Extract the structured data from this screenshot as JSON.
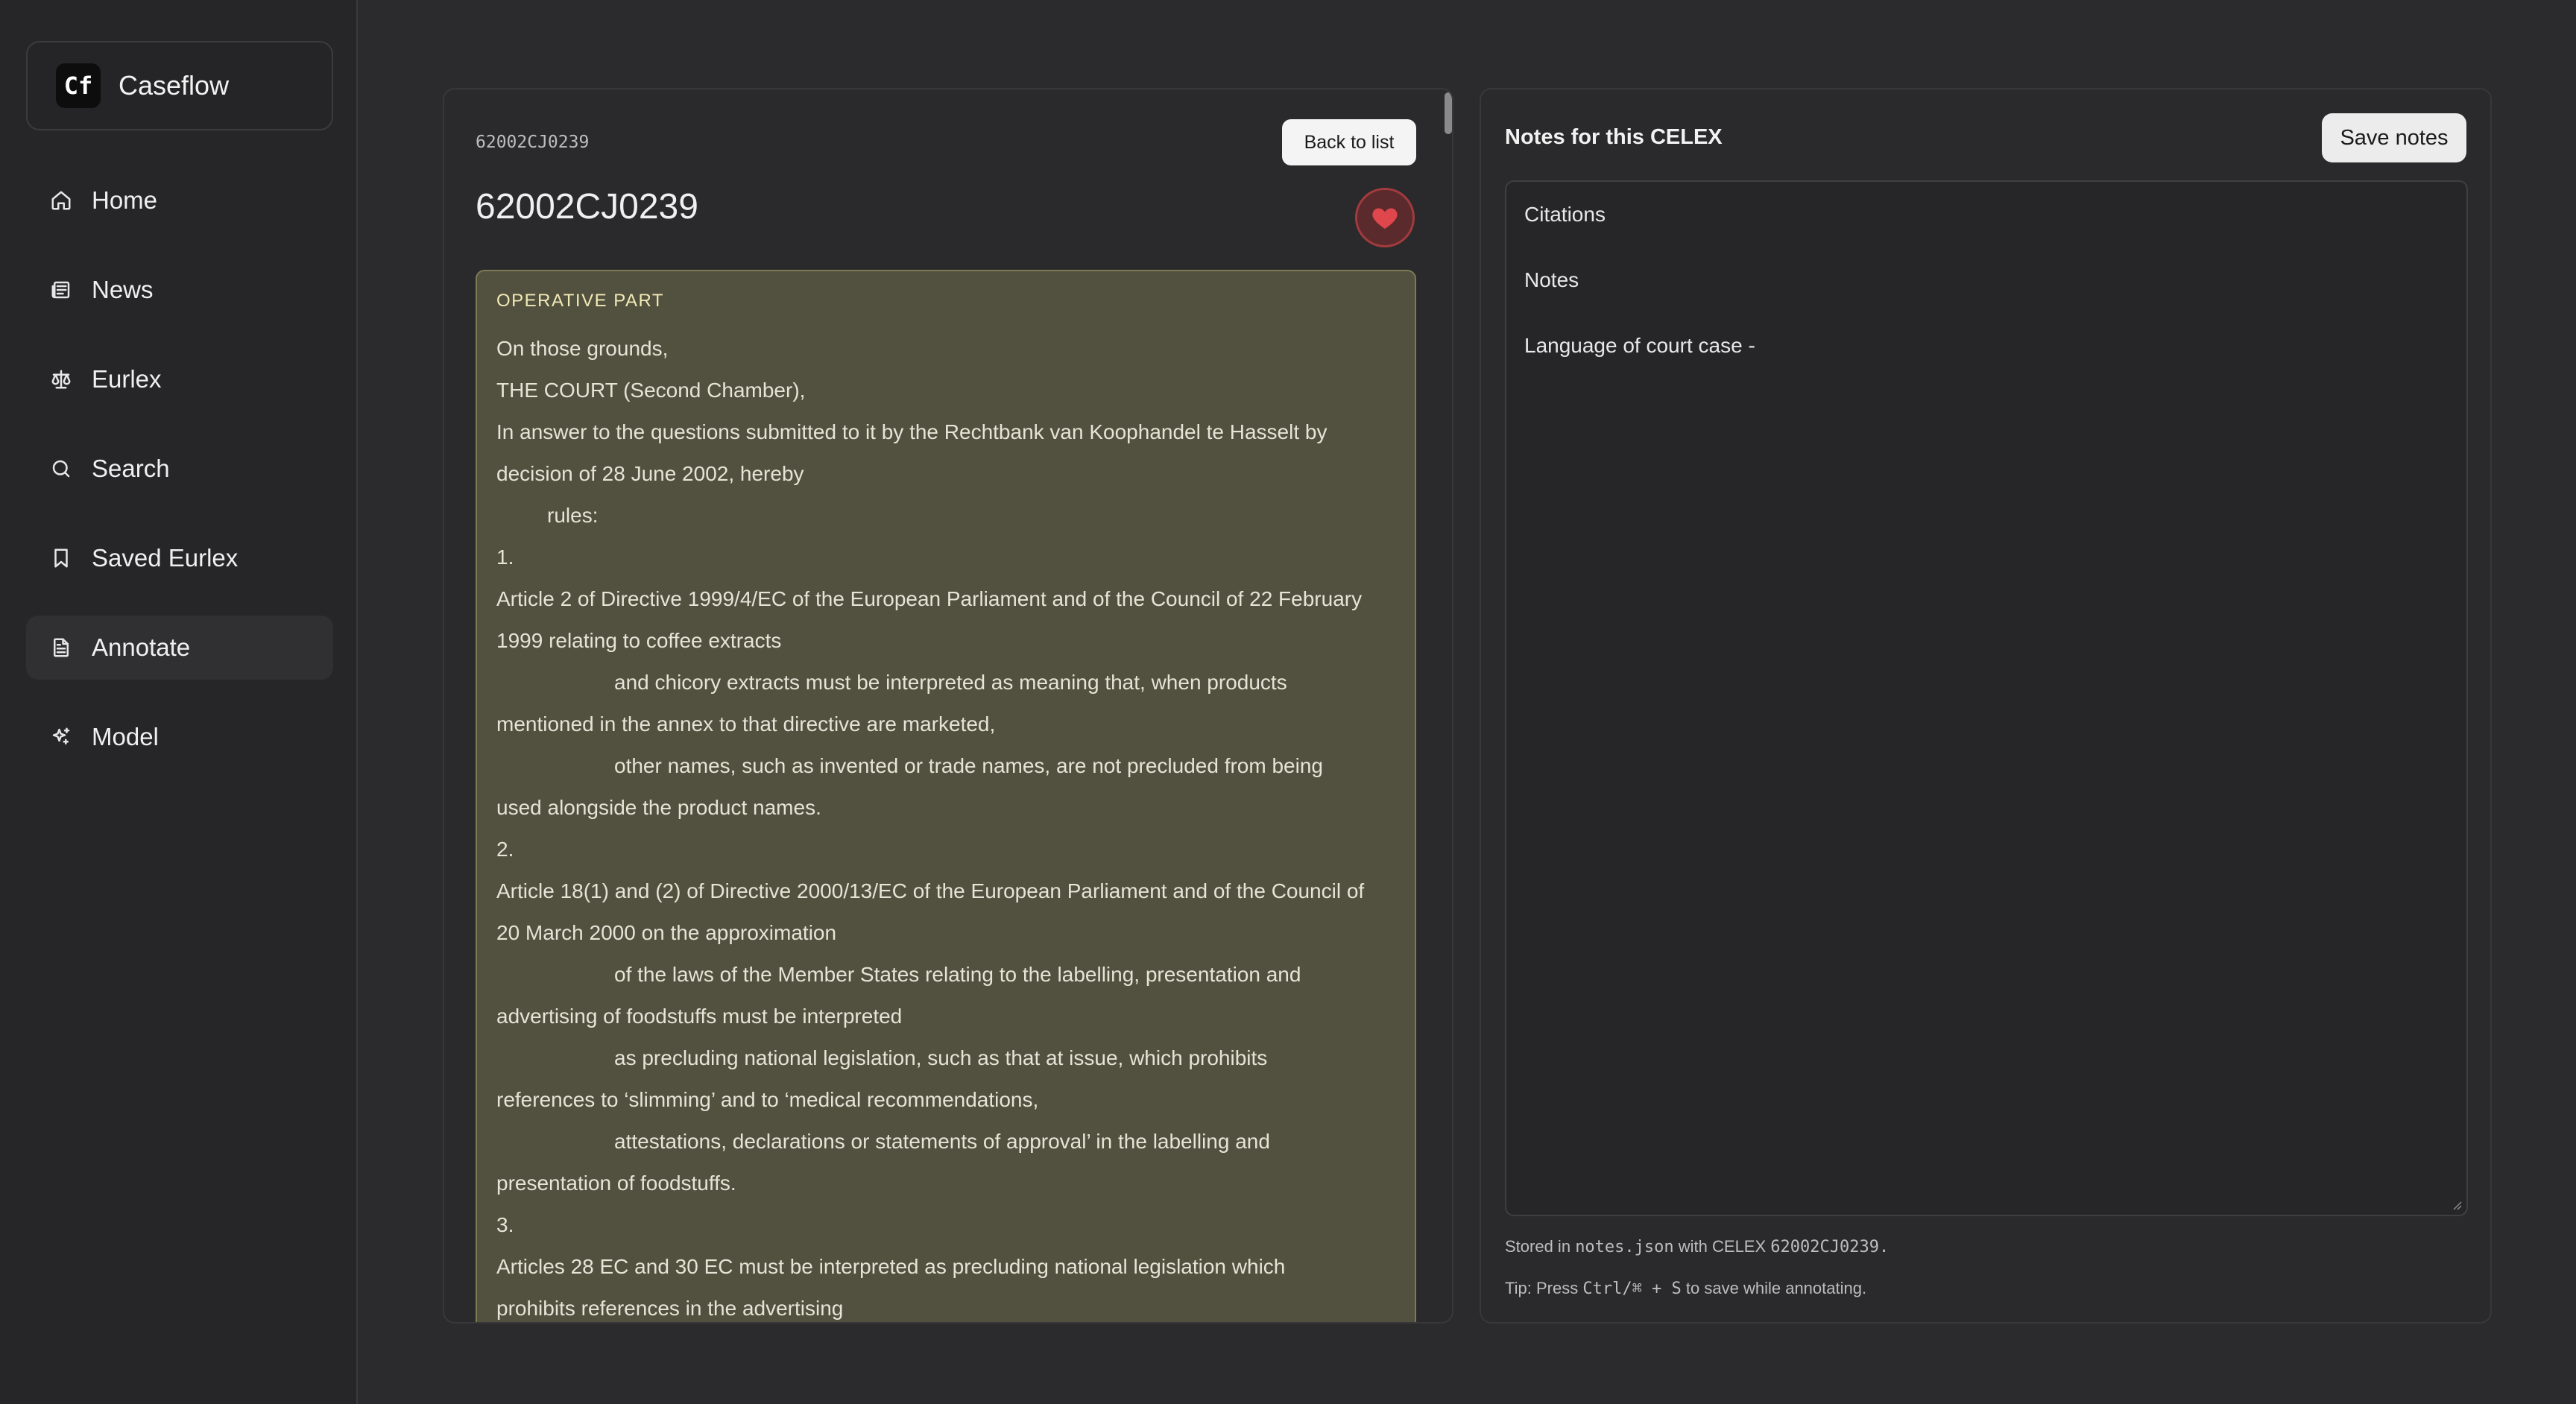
{
  "sidebar": {
    "brand": {
      "logo": "Cf",
      "name": "Caseflow"
    },
    "items": [
      {
        "label": "Home",
        "icon": "home-icon"
      },
      {
        "label": "News",
        "icon": "newspaper-icon"
      },
      {
        "label": "Eurlex",
        "icon": "scale-icon"
      },
      {
        "label": "Search",
        "icon": "search-icon"
      },
      {
        "label": "Saved Eurlex",
        "icon": "bookmark-icon"
      },
      {
        "label": "Annotate",
        "icon": "document-icon",
        "active": true
      },
      {
        "label": "Model",
        "icon": "sparkles-icon"
      }
    ]
  },
  "document": {
    "celex_small": "62002CJ0239",
    "title": "62002CJ0239",
    "back_label": "Back to list",
    "favorite_color": "#e0474c",
    "operative": {
      "heading": "OPERATIVE PART",
      "lines": [
        "On those grounds,",
        "THE COURT (Second Chamber),",
        "In answer to the questions submitted to it by the Rechtbank van Koophandel te Hasselt by",
        "decision of 28 June 2002, hereby",
        "rules:",
        "1.",
        "Article 2 of Directive 1999/4/EC of the European Parliament and of the Council of 22 February",
        "1999 relating to coffee extracts",
        "and chicory extracts must be interpreted as meaning that, when products",
        "mentioned in the annex to that directive are marketed,",
        "other names, such as invented or trade names, are not precluded from being",
        "used alongside the product names.",
        "2.",
        "Article 18(1) and (2) of Directive 2000/13/EC of the European Parliament and of the Council of",
        "20 March 2000 on the approximation",
        "of the laws of the Member States relating to the labelling, presentation and",
        "advertising of foodstuffs must be interpreted",
        "as precluding national legislation, such as that at issue, which prohibits",
        "references to ‘slimming’ and to ‘medical recommendations,",
        "attestations, declarations or statements of approval’ in the labelling and",
        "presentation of foodstuffs.",
        "3.",
        "Articles 28 EC and 30 EC must be interpreted as precluding national legislation which",
        "prohibits references in the advertising"
      ]
    }
  },
  "notes": {
    "title": "Notes for this CELEX",
    "save_label": "Save notes",
    "content_lines": [
      "Citations",
      "Notes",
      "Language of court case -"
    ],
    "stored_prefix": "Stored in",
    "stored_file": "notes.json",
    "stored_mid": "with CELEX",
    "stored_celex": "62002CJ0239.",
    "tip_prefix": "Tip: Press",
    "tip_keys": "Ctrl/⌘ + S",
    "tip_suffix": "to save while annotating."
  }
}
